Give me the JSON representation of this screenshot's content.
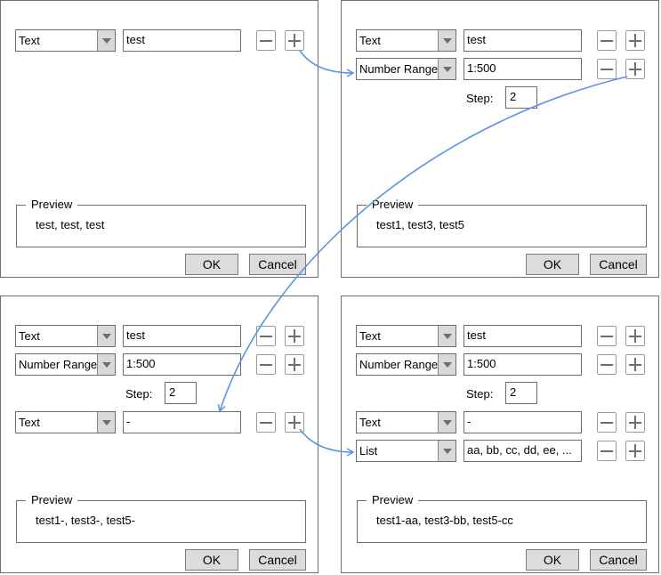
{
  "accent_color": "#5b93e6",
  "panels": [
    {
      "rows": [
        {
          "type": "Text",
          "value": "test"
        }
      ],
      "step": null,
      "preview_label": "Preview",
      "preview_text": "test, test, test",
      "ok_label": "OK",
      "cancel_label": "Cancel"
    },
    {
      "rows": [
        {
          "type": "Text",
          "value": "test"
        },
        {
          "type": "Number Range",
          "value": "1:500"
        }
      ],
      "step": {
        "label": "Step:",
        "value": "2"
      },
      "preview_label": "Preview",
      "preview_text": "test1, test3, test5",
      "ok_label": "OK",
      "cancel_label": "Cancel"
    },
    {
      "rows": [
        {
          "type": "Text",
          "value": "test"
        },
        {
          "type": "Number Range",
          "value": "1:500"
        },
        {
          "type": "Text",
          "value": "-"
        }
      ],
      "step": {
        "label": "Step:",
        "value": "2"
      },
      "preview_label": "Preview",
      "preview_text": "test1-, test3-, test5-",
      "ok_label": "OK",
      "cancel_label": "Cancel"
    },
    {
      "rows": [
        {
          "type": "Text",
          "value": "test"
        },
        {
          "type": "Number Range",
          "value": "1:500"
        },
        {
          "type": "Text",
          "value": "-"
        },
        {
          "type": "List",
          "value": "aa, bb, cc, dd, ee, ..."
        }
      ],
      "step": {
        "label": "Step:",
        "value": "2"
      },
      "preview_label": "Preview",
      "preview_text": "test1-aa, test3-bb, test5-cc",
      "ok_label": "OK",
      "cancel_label": "Cancel"
    }
  ]
}
